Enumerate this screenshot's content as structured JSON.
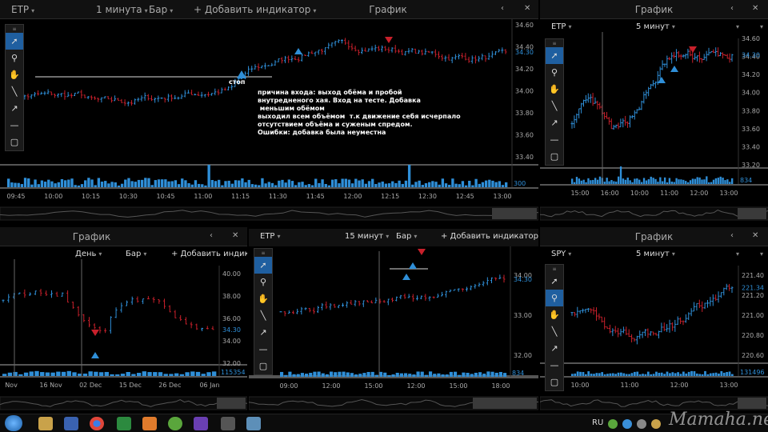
{
  "panels": {
    "main": {
      "symbol": "ETP",
      "interval": "1 минута",
      "chart_type": "Бар",
      "add_indicator": "+ Добавить индикатор",
      "title": "График",
      "price_ticks": [
        "34.60",
        "34.40",
        "34.20",
        "34.00",
        "33.80",
        "33.60",
        "33.40"
      ],
      "current_price": "34.30",
      "volume_label": "300",
      "time_ticks": [
        "09:45",
        "10:00",
        "10:15",
        "10:30",
        "10:45",
        "11:00",
        "11:15",
        "11:30",
        "11:45",
        "12:00",
        "12:15",
        "12:30",
        "12:45",
        "13:00"
      ],
      "stop_label": "стоп",
      "note": "причина входа: выход обёма и пробой\nвнутредненого хая. Вход на тесте. Добавка\n меньшим обёмом\nвыходил всем объёмом  т.к движение себя исчерпало\nотсутствием объёма и суженым спредом.\nОшибки: добавка была неуместна"
    },
    "top_right": {
      "title": "График",
      "symbol": "ETP",
      "interval": "5 минут",
      "price_ticks": [
        "34.60",
        "34.40",
        "34.20",
        "34.00",
        "33.80",
        "33.60",
        "33.40",
        "33.20"
      ],
      "current_price": "34.30",
      "volume_label": "834",
      "time_ticks": [
        "15:00",
        "16:00",
        "10:00",
        "11:00",
        "12:00",
        "13:00"
      ]
    },
    "bottom_left": {
      "title": "График",
      "interval": "День",
      "chart_type": "Бар",
      "add_indicator": "+ Добавить индикатор",
      "price_ticks": [
        "40.00",
        "38.00",
        "36.00",
        "34.00",
        "32.00"
      ],
      "current_price": "34.30",
      "volume_label": "115354",
      "time_ticks": [
        "Nov",
        "16 Nov",
        "02 Dec",
        "15 Dec",
        "26 Dec",
        "06 Jan"
      ]
    },
    "bottom_mid": {
      "symbol": "ETP",
      "interval": "15 минут",
      "chart_type": "Бар",
      "add_indicator": "+ Добавить индикатор",
      "price_ticks": [
        "34.00",
        "33.00",
        "32.00"
      ],
      "current_price": "34.30",
      "volume_label": "834",
      "time_ticks": [
        "09:00",
        "12:00",
        "15:00",
        "12:00",
        "15:00",
        "18:00"
      ]
    },
    "bottom_right": {
      "title": "График",
      "symbol": "SPY",
      "interval": "5 минут",
      "price_ticks": [
        "221.40",
        "221.20",
        "221.00",
        "220.80",
        "220.60"
      ],
      "current_price": "221.34",
      "volume_label": "131496",
      "time_ticks": [
        "10:00",
        "11:00",
        "12:00",
        "13:00"
      ]
    }
  },
  "taskbar": {
    "lang": "RU",
    "watermark": "Mamaha.net"
  },
  "colors": {
    "up": "#2f8fd8",
    "down": "#c8202b",
    "accent": "#1f5fa0"
  }
}
